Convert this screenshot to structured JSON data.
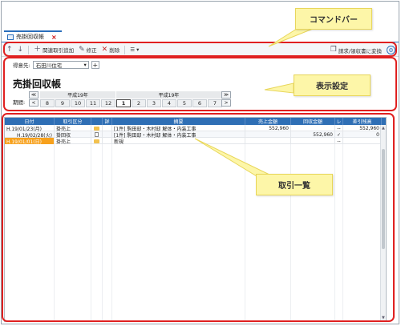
{
  "window": {
    "tab_label": "売掛回収帳",
    "tab_close": "×"
  },
  "toolbar": {
    "up": "↑",
    "down": "↓",
    "add_related": "関連取引追加",
    "edit": "修正",
    "delete": "削除",
    "menu": "☰ ▾",
    "convert": "請求/領収書に変換",
    "settings_icon": "⚙"
  },
  "settings": {
    "client_label": "得意先:",
    "client_value": "石田川住宅",
    "client_plus": "+",
    "title": "売掛回収帳",
    "period_label": "期間:",
    "nav_prev": "≪",
    "nav_next": "≫",
    "eras": [
      "平成19年",
      "平成19年"
    ],
    "months_first": [
      "8",
      "9",
      "10",
      "11",
      "12"
    ],
    "months_second": [
      "1",
      "2",
      "3",
      "4",
      "5",
      "6",
      "7"
    ],
    "selected_month": "1"
  },
  "grid": {
    "headers": [
      "日付",
      "取引区分",
      "",
      "詳",
      "摘要",
      "売上金額",
      "回収金額",
      "レ",
      "差引残高"
    ],
    "rows": [
      {
        "date": "H.19/01/23(月)",
        "type": "掛売上",
        "bracket": "[1件]",
        "desc": "駒田邸・木村邸 解体・内装工事",
        "sales": "552,960",
        "collect": "",
        "check": "--",
        "balance": "552,960"
      },
      {
        "date": "H.19/02/28(火)",
        "type": "掛回収",
        "bracket": "[1件]",
        "desc": "駒田邸・木村邸 解体・内装工事",
        "sales": "",
        "collect": "552,960",
        "check": "✓",
        "balance": "0"
      },
      {
        "date": "H.19/01/01(日)",
        "type": "掛売上",
        "bracket": "",
        "desc": "新規",
        "sales": "",
        "collect": "",
        "check": "--",
        "balance": ""
      }
    ]
  },
  "callouts": {
    "command_bar": "コマンドバー",
    "display_settings": "表示設定",
    "transaction_list": "取引一覧"
  }
}
